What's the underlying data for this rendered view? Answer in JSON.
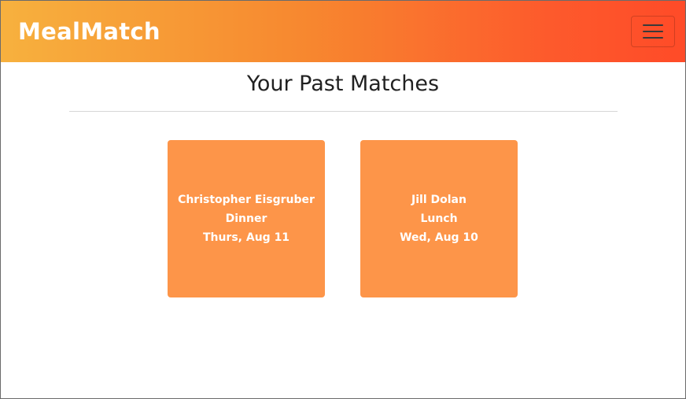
{
  "header": {
    "brand": "MealMatch",
    "menu_icon": "hamburger-menu-icon"
  },
  "main": {
    "title": "Your Past Matches",
    "matches": [
      {
        "name": "Christopher Eisgruber",
        "meal": "Dinner",
        "date": "Thurs, Aug 11"
      },
      {
        "name": "Jill Dolan",
        "meal": "Lunch",
        "date": "Wed, Aug 10"
      }
    ]
  },
  "colors": {
    "header_gradient_start": "#f7b13e",
    "header_gradient_end": "#ff4b28",
    "card_background": "#fd9549",
    "card_text": "#ffffff",
    "title_text": "#212121"
  }
}
